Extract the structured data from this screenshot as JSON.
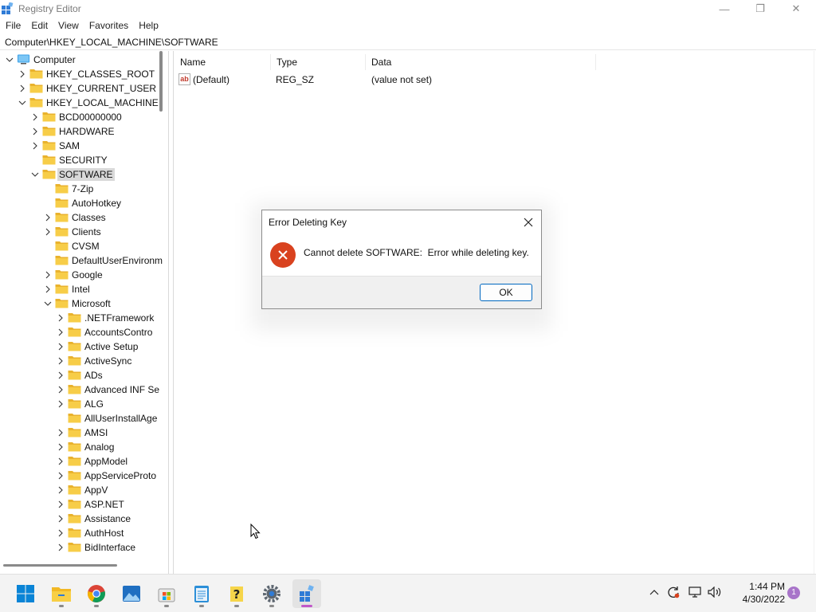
{
  "window": {
    "title": "Registry Editor",
    "controls": {
      "minimize": "—",
      "maximize": "❐",
      "close": "✕"
    }
  },
  "menubar": [
    "File",
    "Edit",
    "View",
    "Favorites",
    "Help"
  ],
  "address": "Computer\\HKEY_LOCAL_MACHINE\\SOFTWARE",
  "tree": [
    {
      "label": "Computer",
      "level": 0,
      "expander": "expanded",
      "icon": "computer-icon"
    },
    {
      "label": "HKEY_CLASSES_ROOT",
      "level": 1,
      "expander": "collapsed",
      "icon": "folder-icon"
    },
    {
      "label": "HKEY_CURRENT_USER",
      "level": 1,
      "expander": "collapsed",
      "icon": "folder-icon"
    },
    {
      "label": "HKEY_LOCAL_MACHINE",
      "level": 1,
      "expander": "expanded",
      "icon": "folder-icon"
    },
    {
      "label": "BCD00000000",
      "level": 2,
      "expander": "collapsed",
      "icon": "folder-icon"
    },
    {
      "label": "HARDWARE",
      "level": 2,
      "expander": "collapsed",
      "icon": "folder-icon"
    },
    {
      "label": "SAM",
      "level": 2,
      "expander": "collapsed",
      "icon": "folder-icon"
    },
    {
      "label": "SECURITY",
      "level": 2,
      "expander": "none",
      "icon": "folder-icon"
    },
    {
      "label": "SOFTWARE",
      "level": 2,
      "expander": "expanded",
      "icon": "folder-icon",
      "selected": true
    },
    {
      "label": "7-Zip",
      "level": 3,
      "expander": "none",
      "icon": "folder-icon"
    },
    {
      "label": "AutoHotkey",
      "level": 3,
      "expander": "none",
      "icon": "folder-icon"
    },
    {
      "label": "Classes",
      "level": 3,
      "expander": "collapsed",
      "icon": "folder-icon"
    },
    {
      "label": "Clients",
      "level": 3,
      "expander": "collapsed",
      "icon": "folder-icon"
    },
    {
      "label": "CVSM",
      "level": 3,
      "expander": "none",
      "icon": "folder-icon"
    },
    {
      "label": "DefaultUserEnvironm",
      "level": 3,
      "expander": "none",
      "icon": "folder-icon"
    },
    {
      "label": "Google",
      "level": 3,
      "expander": "collapsed",
      "icon": "folder-icon"
    },
    {
      "label": "Intel",
      "level": 3,
      "expander": "collapsed",
      "icon": "folder-icon"
    },
    {
      "label": "Microsoft",
      "level": 3,
      "expander": "expanded",
      "icon": "folder-icon"
    },
    {
      "label": ".NETFramework",
      "level": 4,
      "expander": "collapsed",
      "icon": "folder-icon"
    },
    {
      "label": "AccountsContro",
      "level": 4,
      "expander": "collapsed",
      "icon": "folder-icon"
    },
    {
      "label": "Active Setup",
      "level": 4,
      "expander": "collapsed",
      "icon": "folder-icon"
    },
    {
      "label": "ActiveSync",
      "level": 4,
      "expander": "collapsed",
      "icon": "folder-icon"
    },
    {
      "label": "ADs",
      "level": 4,
      "expander": "collapsed",
      "icon": "folder-icon"
    },
    {
      "label": "Advanced INF Se",
      "level": 4,
      "expander": "collapsed",
      "icon": "folder-icon"
    },
    {
      "label": "ALG",
      "level": 4,
      "expander": "collapsed",
      "icon": "folder-icon"
    },
    {
      "label": "AllUserInstallAge",
      "level": 4,
      "expander": "none",
      "icon": "folder-icon"
    },
    {
      "label": "AMSI",
      "level": 4,
      "expander": "collapsed",
      "icon": "folder-icon"
    },
    {
      "label": "Analog",
      "level": 4,
      "expander": "collapsed",
      "icon": "folder-icon"
    },
    {
      "label": "AppModel",
      "level": 4,
      "expander": "collapsed",
      "icon": "folder-icon"
    },
    {
      "label": "AppServiceProto",
      "level": 4,
      "expander": "collapsed",
      "icon": "folder-icon"
    },
    {
      "label": "AppV",
      "level": 4,
      "expander": "collapsed",
      "icon": "folder-icon"
    },
    {
      "label": "ASP.NET",
      "level": 4,
      "expander": "collapsed",
      "icon": "folder-icon"
    },
    {
      "label": "Assistance",
      "level": 4,
      "expander": "collapsed",
      "icon": "folder-icon"
    },
    {
      "label": "AuthHost",
      "level": 4,
      "expander": "collapsed",
      "icon": "folder-icon"
    },
    {
      "label": "BidInterface",
      "level": 4,
      "expander": "collapsed",
      "icon": "folder-icon"
    }
  ],
  "values": {
    "columns": [
      "Name",
      "Type",
      "Data"
    ],
    "rows": [
      {
        "icon": "string-value-icon",
        "icon_text": "ab",
        "name": "(Default)",
        "type": "REG_SZ",
        "data": "(value not set)"
      }
    ]
  },
  "dialog": {
    "title": "Error Deleting Key",
    "message": "Cannot delete SOFTWARE:  Error while deleting key.",
    "ok_label": "OK",
    "close_glyph": "✕"
  },
  "taskbar": {
    "apps": [
      {
        "name": "start-button",
        "icon": "windows-logo-icon"
      },
      {
        "name": "file-explorer",
        "icon": "folder-icon",
        "running": true
      },
      {
        "name": "chrome",
        "icon": "chrome-icon",
        "running": true
      },
      {
        "name": "photos",
        "icon": "photos-icon"
      },
      {
        "name": "store",
        "icon": "store-icon",
        "running": true
      },
      {
        "name": "notepad",
        "icon": "notepad-icon",
        "running": true
      },
      {
        "name": "help",
        "icon": "help-icon",
        "running": true
      },
      {
        "name": "settings",
        "icon": "gear-icon",
        "running": true
      },
      {
        "name": "registry-editor",
        "icon": "registry-icon",
        "running": true,
        "active": true
      }
    ],
    "tray": [
      "chevron-up-icon",
      "sync-icon",
      "network-icon",
      "volume-icon"
    ],
    "time": "1:44 PM",
    "date": "4/30/2022",
    "notification_count": "1"
  },
  "colors": {
    "accent": "#0067c0",
    "error": "#d9421f",
    "folder": "#f6c342",
    "selection": "#d9d9d9"
  }
}
